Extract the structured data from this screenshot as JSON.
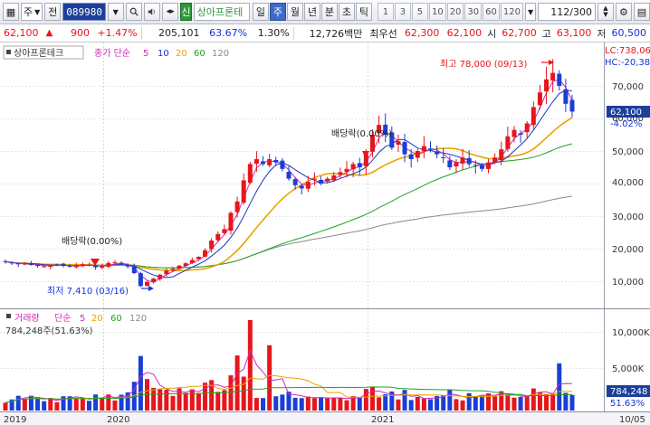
{
  "toolbar": {
    "market": "주",
    "prev": "전",
    "code": "089980",
    "shin": "신",
    "stock_name": "상아프론테",
    "periods": [
      "일",
      "주",
      "월",
      "년",
      "분",
      "초",
      "틱"
    ],
    "active_period": "주",
    "intervals": [
      "1",
      "3",
      "5",
      "10",
      "20",
      "30",
      "60",
      "120"
    ],
    "count": "112/300"
  },
  "quote": {
    "price": "62,100",
    "change": "900",
    "change_pct": "+1.47%",
    "volume": "205,101",
    "vol_ratio": "63.67%",
    "turnover": "1.30%",
    "amount": "12,726백만",
    "basis_label": "최우선",
    "ask": "62,300",
    "bid": "62,100",
    "open_label": "시",
    "open": "62,700",
    "high_label": "고",
    "high": "63,100",
    "low_label": "저",
    "low": "60,500"
  },
  "price_panel": {
    "name": "상아프론테크",
    "legend_prefix": "종가 단순",
    "ma_periods": [
      "5",
      "10",
      "20",
      "60",
      "120"
    ],
    "lc": "LC:738,06",
    "hc": "HC:-20,38",
    "price_tag": "62,100",
    "pct_tag": "-4.02%",
    "annotations": {
      "high": "최고 78,000 (09/13)",
      "low": "최저 7,410 (03/16)",
      "div1": "배당락(0.00%)",
      "div2": "배당락(0.00%)"
    },
    "y_ticks": [
      "70,000",
      "60,000",
      "50,000",
      "40,000",
      "30,000",
      "20,000",
      "10,000"
    ]
  },
  "volume_panel": {
    "name": "거래량",
    "legend_prefix": "단순",
    "ma_periods": [
      "5",
      "20",
      "60",
      "120"
    ],
    "current": "784,248주(51.63%)",
    "vol_tag": "784,248",
    "pct_tag": "51.63%",
    "y_ticks": [
      "10,000K",
      "5,000K"
    ]
  },
  "x_axis": {
    "labels": [
      "2019",
      "2020",
      "2021"
    ],
    "right_label": "10/05"
  },
  "colors": {
    "up": "#e5161c",
    "down": "#1a3fd6",
    "ma5": "#d228b8",
    "ma10": "#1d33c8",
    "ma20": "#e7a400",
    "ma60": "#21a125",
    "ma120": "#8a8a8a"
  },
  "chart_data": {
    "type": "candlestick",
    "title": "상아프론테크",
    "y_range": [
      5000,
      80000
    ],
    "weekly_close_approx": [
      16000,
      15500,
      15200,
      15400,
      15000,
      14800,
      14600,
      14900,
      15100,
      14700,
      14500,
      14800,
      15200,
      15000,
      14300,
      14600,
      15600,
      15800,
      15300,
      14500,
      12500,
      8500,
      9800,
      10800,
      12000,
      13200,
      13800,
      14800,
      15500,
      16500,
      17500,
      19500,
      22500,
      24500,
      26000,
      31000,
      34500,
      41000,
      46000,
      47500,
      46000,
      47500,
      46500,
      44500,
      41500,
      39500,
      38500,
      40500,
      41500,
      40000,
      41500,
      42500,
      43500,
      44500,
      46000,
      45000,
      49000,
      55000,
      58000,
      55000,
      51000,
      53000,
      49000,
      47500,
      50000,
      51500,
      50500,
      49000,
      48000,
      45000,
      46500,
      48000,
      46000,
      45500,
      44500,
      46500,
      48000,
      50500,
      54500,
      56500,
      55000,
      58500,
      63500,
      68000,
      72000,
      74000,
      70000,
      64500,
      62100
    ],
    "volume_max_k": 12000
  }
}
